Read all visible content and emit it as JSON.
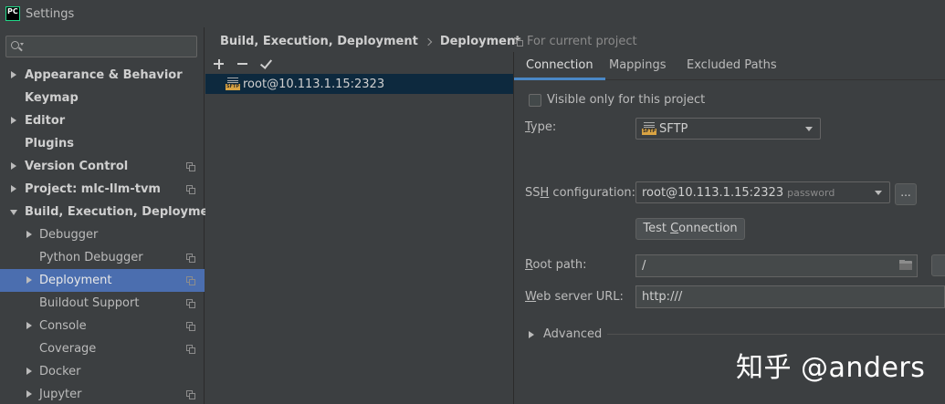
{
  "window": {
    "app_logo_text": "PC",
    "title": "Settings"
  },
  "search": {
    "value": "",
    "placeholder": ""
  },
  "sidebar": {
    "items": [
      {
        "label": "Appearance & Behavior",
        "level": 0,
        "arrow": "right",
        "copy": false
      },
      {
        "label": "Keymap",
        "level": 0,
        "arrow": "none",
        "copy": false
      },
      {
        "label": "Editor",
        "level": 0,
        "arrow": "right",
        "copy": false
      },
      {
        "label": "Plugins",
        "level": 0,
        "arrow": "none",
        "copy": false
      },
      {
        "label": "Version Control",
        "level": 0,
        "arrow": "right",
        "copy": true
      },
      {
        "label": "Project: mlc-llm-tvm",
        "level": 0,
        "arrow": "right",
        "copy": true
      },
      {
        "label": "Build, Execution, Deployment",
        "level": 0,
        "arrow": "down",
        "copy": false
      },
      {
        "label": "Debugger",
        "level": 1,
        "arrow": "right",
        "copy": false
      },
      {
        "label": "Python Debugger",
        "level": 1,
        "arrow": "none",
        "copy": true
      },
      {
        "label": "Deployment",
        "level": 1,
        "arrow": "right",
        "copy": true,
        "selected": true
      },
      {
        "label": "Buildout Support",
        "level": 1,
        "arrow": "none",
        "copy": true
      },
      {
        "label": "Console",
        "level": 1,
        "arrow": "right",
        "copy": true
      },
      {
        "label": "Coverage",
        "level": 1,
        "arrow": "none",
        "copy": true
      },
      {
        "label": "Docker",
        "level": 1,
        "arrow": "right",
        "copy": false
      },
      {
        "label": "Jupyter",
        "level": 1,
        "arrow": "right",
        "copy": true
      }
    ]
  },
  "breadcrumb": {
    "parent": "Build, Execution, Deployment",
    "current": "Deployment"
  },
  "scope_note": "For current project",
  "server_list": {
    "items": [
      {
        "label": "root@10.113.1.15:2323",
        "icon_tag": "SFTP"
      }
    ]
  },
  "tabs": [
    {
      "label": "Connection",
      "active": true
    },
    {
      "label": "Mappings",
      "active": false
    },
    {
      "label": "Excluded Paths",
      "active": false
    }
  ],
  "form": {
    "visible_only_label": "Visible only for this project",
    "visible_only_checked": false,
    "type_label_first": "T",
    "type_label_rest": "ype:",
    "type_value": "SFTP",
    "ssh_label_prefix": "SS",
    "ssh_label_mnemonic": "H",
    "ssh_label_rest": " configuration:",
    "ssh_value": "root@10.113.1.15:2323",
    "ssh_auth": "password",
    "ssh_browse_label": "...",
    "test_label_prefix": "Test ",
    "test_label_mnemonic": "C",
    "test_label_rest": "onnection",
    "root_label_mnemonic": "R",
    "root_label_rest": "oot path:",
    "root_value": "/",
    "web_label_mnemonic": "W",
    "web_label_rest": "eb server URL:",
    "web_value": "http:///",
    "advanced_label": "Advanced"
  },
  "watermark": "知乎 @anders"
}
